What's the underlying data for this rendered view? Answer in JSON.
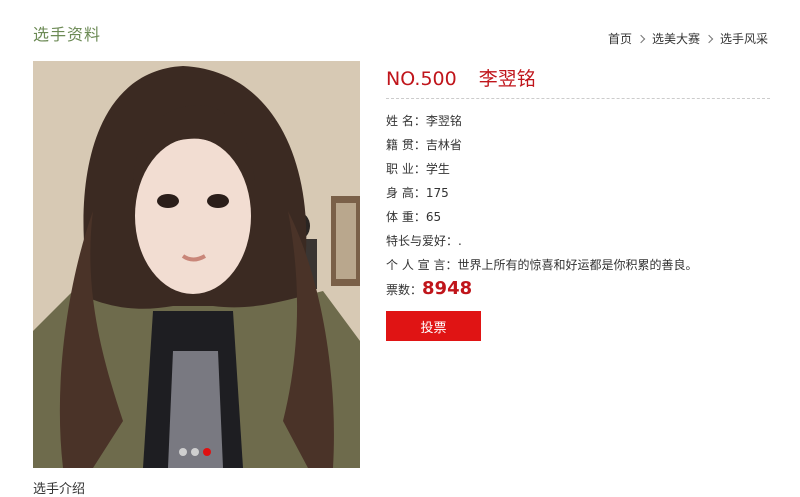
{
  "page": {
    "title": "选手资料",
    "section_label": "选手介绍"
  },
  "breadcrumb": [
    "首页",
    "选美大赛",
    "选手风采"
  ],
  "contestant": {
    "number": "NO.500",
    "name": "李翌铭",
    "fields": [
      {
        "label": "姓 名：",
        "value": "李翌铭"
      },
      {
        "label": "籍 贯：",
        "value": "吉林省"
      },
      {
        "label": "职 业：",
        "value": "学生"
      },
      {
        "label": "身 高：",
        "value": "175"
      },
      {
        "label": "体 重：",
        "value": "65"
      },
      {
        "label": "特长与爱好：",
        "value": "."
      },
      {
        "label": "个 人 宣 言：",
        "value": "世界上所有的惊喜和好运都是你积累的善良。"
      }
    ],
    "votes_label": "票数：",
    "votes": "8948",
    "vote_button": "投票"
  },
  "carousel": {
    "count": 3,
    "active": 3
  },
  "colors": {
    "accent": "#c0151b",
    "button": "#e01414",
    "title": "#6c8a55"
  }
}
